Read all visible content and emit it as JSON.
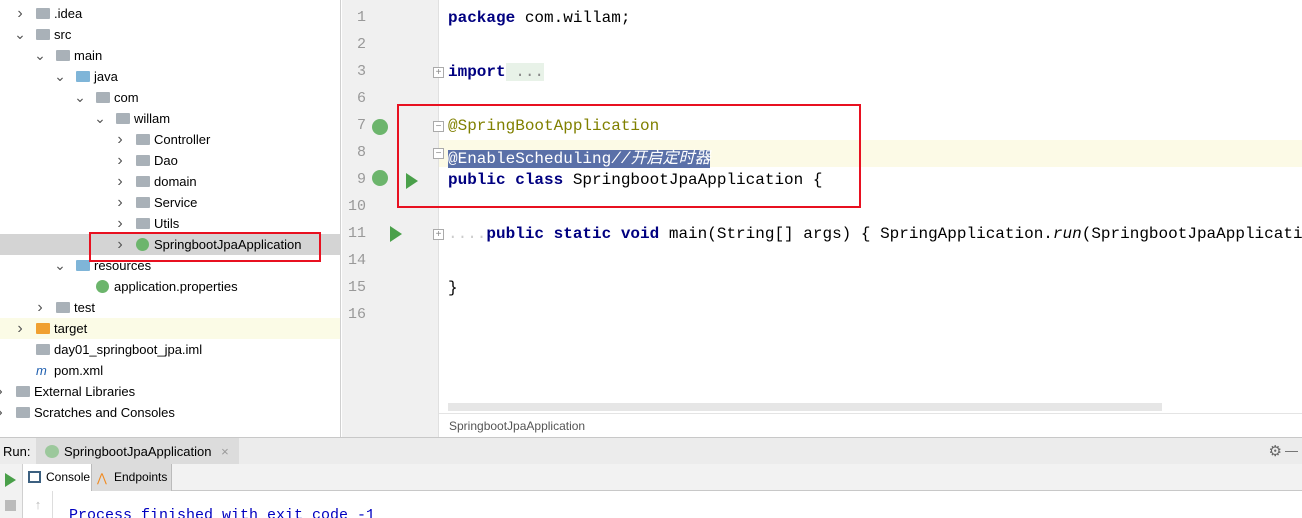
{
  "project_tree": [
    {
      "label": ".idea",
      "depth": 0,
      "arrow": "right",
      "icon": "folder-icon"
    },
    {
      "label": "src",
      "depth": 0,
      "arrow": "down",
      "icon": "folder-icon"
    },
    {
      "label": "main",
      "depth": 1,
      "arrow": "down",
      "icon": "folder-icon"
    },
    {
      "label": "java",
      "depth": 2,
      "arrow": "down",
      "icon": "source-folder-icon"
    },
    {
      "label": "com",
      "depth": 3,
      "arrow": "down",
      "icon": "package-icon"
    },
    {
      "label": "willam",
      "depth": 4,
      "arrow": "down",
      "icon": "package-icon"
    },
    {
      "label": "Controller",
      "depth": 5,
      "arrow": "right",
      "icon": "package-icon"
    },
    {
      "label": "Dao",
      "depth": 5,
      "arrow": "right",
      "icon": "package-icon"
    },
    {
      "label": "domain",
      "depth": 5,
      "arrow": "right",
      "icon": "package-icon"
    },
    {
      "label": "Service",
      "depth": 5,
      "arrow": "right",
      "icon": "package-icon"
    },
    {
      "label": "Utils",
      "depth": 5,
      "arrow": "right",
      "icon": "package-icon"
    },
    {
      "label": "SpringbootJpaApplication",
      "depth": 5,
      "arrow": "right",
      "icon": "spring-class-icon",
      "selected": true
    },
    {
      "label": "resources",
      "depth": 2,
      "arrow": "down",
      "icon": "resources-folder-icon"
    },
    {
      "label": "application.properties",
      "depth": 3,
      "arrow": "",
      "icon": "spring-properties-icon"
    },
    {
      "label": "test",
      "depth": 1,
      "arrow": "right",
      "icon": "folder-icon"
    },
    {
      "label": "target",
      "depth": 0,
      "arrow": "right",
      "icon": "excluded-folder-icon",
      "highlight": true
    },
    {
      "label": "day01_springboot_jpa.iml",
      "depth": 0,
      "arrow": "",
      "icon": "iml-file-icon"
    },
    {
      "label": "pom.xml",
      "depth": 0,
      "arrow": "",
      "icon": "maven-icon"
    },
    {
      "label": "External Libraries",
      "depth": -1,
      "arrow": "right",
      "icon": "libraries-icon"
    },
    {
      "label": "Scratches and Consoles",
      "depth": -1,
      "arrow": "right",
      "icon": "scratches-icon"
    }
  ],
  "editor": {
    "line_numbers": [
      "1",
      "2",
      "3",
      "6",
      "7",
      "8",
      "9",
      "10",
      "11",
      "14",
      "15",
      "16"
    ],
    "code": {
      "l1_kw": "package",
      "l1_rest": " com.willam;",
      "l3_kw": "import",
      "l3_rest": " ...",
      "l7_ann": "@SpringBootApplication",
      "l8_ann": "@EnableScheduling",
      "l8_comment": "//开启定时器",
      "l9_kw": "public class",
      "l9_rest": " SpringbootJpaApplication {",
      "l11_indent": "....",
      "l11_kw": "public static void",
      "l11_rest": " main(String[] args) { SpringApplication.",
      "l11_italic": "run",
      "l11_tail": "(SpringbootJpaApplication.c",
      "l15": "}"
    },
    "breadcrumb": "SpringbootJpaApplication"
  },
  "run_panel": {
    "label": "Run:",
    "tab": "SpringbootJpaApplication",
    "subtabs": [
      "Console",
      "Endpoints"
    ],
    "console_text": "Process finished with exit code -1"
  },
  "colors": {
    "highlight_box": "#e81020",
    "selection": "#5a70a8",
    "keyword": "#000080",
    "annotation": "#808000"
  }
}
